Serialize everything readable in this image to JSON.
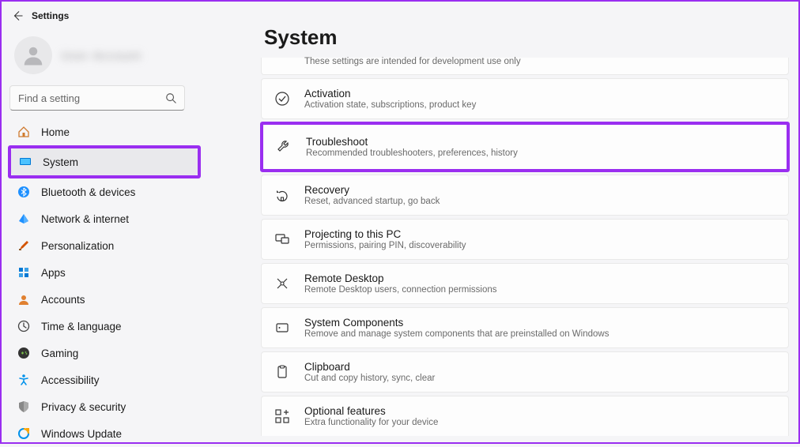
{
  "app_title": "Settings",
  "profile_name": "User Account",
  "search": {
    "placeholder": "Find a setting"
  },
  "sidebar": {
    "items": [
      {
        "id": "home",
        "label": "Home"
      },
      {
        "id": "system",
        "label": "System"
      },
      {
        "id": "bluetooth",
        "label": "Bluetooth & devices"
      },
      {
        "id": "network",
        "label": "Network & internet"
      },
      {
        "id": "personalization",
        "label": "Personalization"
      },
      {
        "id": "apps",
        "label": "Apps"
      },
      {
        "id": "accounts",
        "label": "Accounts"
      },
      {
        "id": "time",
        "label": "Time & language"
      },
      {
        "id": "gaming",
        "label": "Gaming"
      },
      {
        "id": "accessibility",
        "label": "Accessibility"
      },
      {
        "id": "privacy",
        "label": "Privacy & security"
      },
      {
        "id": "update",
        "label": "Windows Update"
      }
    ]
  },
  "main": {
    "title": "System",
    "top_partial": "These settings are intended for development use only",
    "items": [
      {
        "id": "activation",
        "title": "Activation",
        "sub": "Activation state, subscriptions, product key"
      },
      {
        "id": "troubleshoot",
        "title": "Troubleshoot",
        "sub": "Recommended troubleshooters, preferences, history"
      },
      {
        "id": "recovery",
        "title": "Recovery",
        "sub": "Reset, advanced startup, go back"
      },
      {
        "id": "projecting",
        "title": "Projecting to this PC",
        "sub": "Permissions, pairing PIN, discoverability"
      },
      {
        "id": "remote",
        "title": "Remote Desktop",
        "sub": "Remote Desktop users, connection permissions"
      },
      {
        "id": "components",
        "title": "System Components",
        "sub": "Remove and manage system components that are preinstalled on Windows"
      },
      {
        "id": "clipboard",
        "title": "Clipboard",
        "sub": "Cut and copy history, sync, clear"
      },
      {
        "id": "optional",
        "title": "Optional features",
        "sub": "Extra functionality for your device"
      }
    ]
  },
  "highlights": {
    "sidebar": "system",
    "main_item": "troubleshoot"
  }
}
